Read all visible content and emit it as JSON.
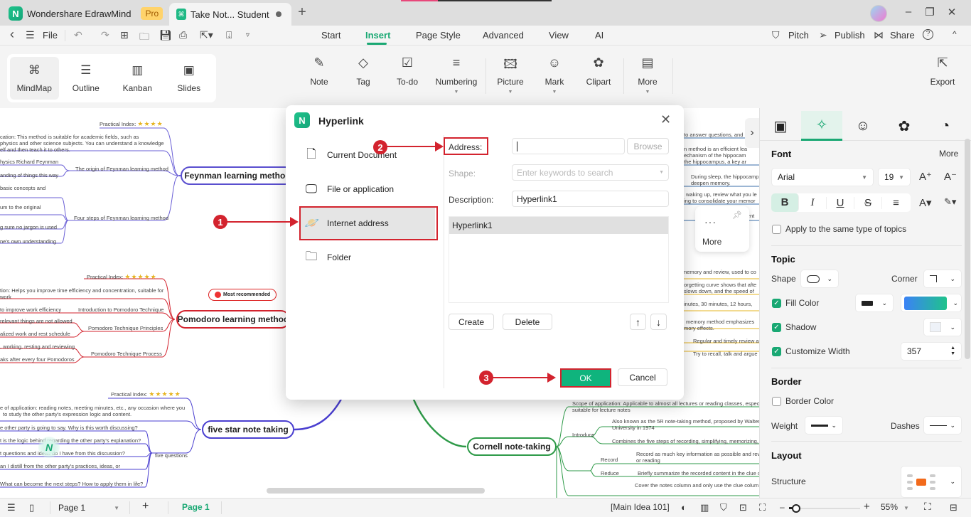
{
  "titlebar": {
    "app_name": "Wondershare EdrawMind",
    "pro_badge": "Pro",
    "doc_tab_title": "Take Not... Student",
    "new_tab": "+",
    "minimize": "–",
    "restore": "❐",
    "close": "✕"
  },
  "menubar": {
    "back": "‹",
    "menu": "☰",
    "file": "File",
    "undo": "↶",
    "redo": "↷",
    "tabs": [
      "Start",
      "Insert",
      "Page Style",
      "Advanced",
      "View",
      "AI"
    ],
    "active_tab": "Insert",
    "pitch": "Pitch",
    "publish": "Publish",
    "share": "Share",
    "help": "?",
    "collapse": "^"
  },
  "ribbon": {
    "views": [
      {
        "label": "MindMap",
        "icon": "mindmap-icon",
        "glyph": "⌘"
      },
      {
        "label": "Outline",
        "icon": "outline-icon",
        "glyph": "☰"
      },
      {
        "label": "Kanban",
        "icon": "kanban-icon",
        "glyph": "▥"
      },
      {
        "label": "Slides",
        "icon": "slides-icon",
        "glyph": "▣"
      }
    ],
    "active_view": "MindMap",
    "buttons": [
      {
        "label": "Note",
        "glyph": "✎"
      },
      {
        "label": "Tag",
        "glyph": "◇"
      },
      {
        "label": "To-do",
        "glyph": "☑"
      },
      {
        "label": "Numbering",
        "glyph": "≡"
      },
      {
        "label": "Picture",
        "glyph": "🖾"
      },
      {
        "label": "Mark",
        "glyph": "☺"
      },
      {
        "label": "Clipart",
        "glyph": "✿"
      },
      {
        "label": "More",
        "glyph": "▤"
      }
    ],
    "export": {
      "label": "Export",
      "glyph": "⇱"
    }
  },
  "canvas": {
    "topics": [
      {
        "label": "Feynman learning method",
        "color": "#5a4fcf"
      },
      {
        "label": "Pomodoro learning method",
        "color": "#d3232e"
      },
      {
        "label": "five star note taking",
        "color": "#4a3fd0"
      },
      {
        "label": "Cornell note-taking",
        "color": "#2e9a48"
      }
    ],
    "callout": "Most recommended",
    "feynman": {
      "practical": "Practical Index:",
      "stars": "★★★★",
      "app1": "cation: This method is suitable for academic fields, such as",
      "app2": "physics and other science subjects. You can understand a knowledge",
      "app3": "elf and then teach it to others.",
      "orig1": "hysics Richard Feynman",
      "orig2": "anding of things this way",
      "origin": "The origin of Feynman learning method",
      "step1": "basic concepts and",
      "step2": "um to the original",
      "step3": "g sure no jargon is used",
      "step4": "ne's own understanding",
      "steps": "Four steps of Feynman learning method"
    },
    "pomodoro": {
      "practical": "Practical Index:",
      "stars": "★★★★★",
      "app1": "tion: Helps you improve time efficiency and concentration, suitable for",
      "app2": "work",
      "intro_l": "to improve work efficiency",
      "intro": "Introduction to Pomodoro Technique",
      "p1": "relevant things are not allowed",
      "p2": "alized work and rest schedule",
      "principles": "Pomodoro Technique Principles",
      "pr1": ", working, resting and reviewing",
      "pr2": "aks after every four Pomodoros",
      "process": "Pomodoro Technique Process"
    },
    "fivestar": {
      "practical": "Practical Index:",
      "stars": "★★★★★",
      "app1": "e of application: reading notes, meeting minutes, etc., any occasion where you",
      "app2": "to study the other party's expression logic and content.",
      "q1": "e other party is going to say. Why is this worth discussing?",
      "q2": "t is the logic behind regarding the other party's explanation?",
      "q3": "t questions and ideas do I have from this discussion?",
      "q4": "an I distill from the other party's practices, ideas, or",
      "q5": "What can become the next steps? How to apply them in life?",
      "questions": "five questions"
    },
    "cornell": {
      "scope1": "Scope of application: Applicable to almost all lectures or reading classes, especi",
      "scope2": "suitable for lecture notes",
      "introduce": "Introduce",
      "i1": "Also known as the 5R note-taking method, proposed by Walter",
      "i2": "University in 1974",
      "i3": "Combines the five steps of recording, simplifying, memorizing, t",
      "record": "Record",
      "r1": "Record as much key information as possible and rev",
      "r2": "or reading",
      "reduce": "Reduce",
      "rd1": "Briefly summarize the recorded content in the clue c",
      "cover": "Cover the notes column and only use the clue colum"
    },
    "right_side": [
      "to answer questions, and i",
      "n method is an efficient lea",
      "echanism of the hippocam",
      "the hippocampus, a key ar",
      "During sleep, the hippocamp",
      "deepen memory.",
      "waking up, review what you le",
      "ing to consolidate your memor",
      "hunger endorsement",
      "memory and review, used to co",
      "forgetting curve shows that afte",
      "slows down, and the speed of",
      "inutes, 30 minutes, 12 hours,",
      "memory method emphasizes",
      "mory effects.",
      "Regular and timely review a",
      "Try to recall, talk and argue"
    ],
    "float_more": "More",
    "float_more_dots": "···"
  },
  "dialog": {
    "title": "Hyperlink",
    "close": "✕",
    "nav": [
      {
        "label": "Current Document",
        "glyph": "🗋"
      },
      {
        "label": "File or application",
        "glyph": "🖵"
      },
      {
        "label": "Internet address",
        "glyph": "🪐"
      },
      {
        "label": "Folder",
        "glyph": "🗀"
      }
    ],
    "active_nav": "Internet address",
    "address_label": "Address:",
    "address_value": "",
    "browse": "Browse",
    "shape_label": "Shape:",
    "shape_placeholder": "Enter keywords to search",
    "description_label": "Description:",
    "description_value": "Hyperlink1",
    "list_items": [
      "Hyperlink1"
    ],
    "create": "Create",
    "delete": "Delete",
    "up": "↑",
    "down": "↓",
    "ok": "OK",
    "cancel": "Cancel"
  },
  "annotations": [
    "1",
    "2",
    "3"
  ],
  "right_panel": {
    "tabs": [
      "style-icon",
      "ai-sparkle-icon",
      "mark-icon",
      "clipart-icon",
      "history-icon"
    ],
    "font_title": "Font",
    "more": "More",
    "font_family": "Arial",
    "font_size": "19",
    "apply_same": "Apply to the same type of topics",
    "apply_same_checked": false,
    "topic_title": "Topic",
    "shape": "Shape",
    "corner": "Corner",
    "fill_color": "Fill Color",
    "fill_checked": true,
    "shadow": "Shadow",
    "shadow_checked": true,
    "customize_width": "Customize Width",
    "customize_width_checked": true,
    "width_value": "357",
    "border_title": "Border",
    "border_color": "Border Color",
    "border_color_checked": false,
    "weight": "Weight",
    "dashes": "Dashes",
    "layout_title": "Layout",
    "structure": "Structure",
    "colors": {
      "accent": "#19a873",
      "fill_gradient_start": "#3b82f6",
      "fill_gradient_end": "#1fc38b",
      "structure_accent": "#f26a1b"
    }
  },
  "statusbar": {
    "page_select": "Page 1",
    "add_page": "+",
    "active_page": "Page 1",
    "main_idea": "[Main Idea 101]",
    "zoom_minus": "–",
    "zoom_plus": "+",
    "zoom_level": "55%",
    "zoom_fraction": 0.1
  }
}
